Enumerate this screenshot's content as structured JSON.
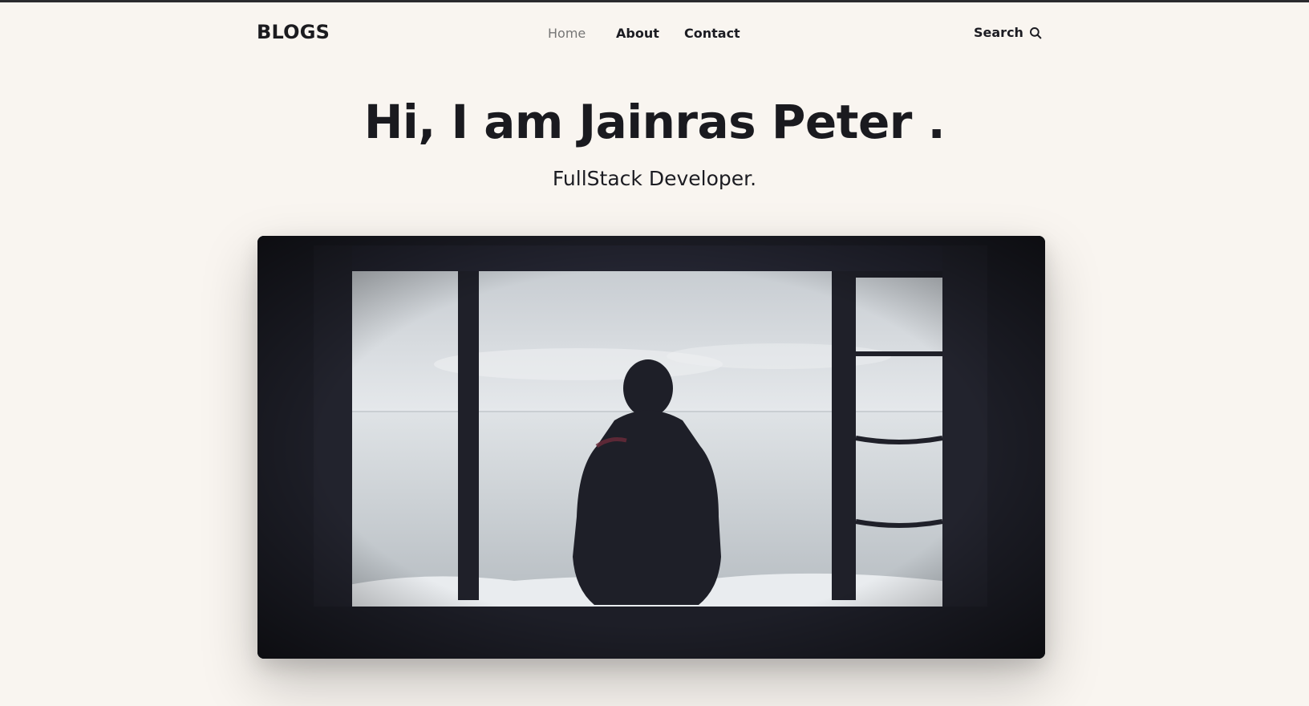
{
  "brand": "BLOGS",
  "nav": {
    "items": [
      {
        "label": "Home",
        "active": true
      },
      {
        "label": "About",
        "active": false
      },
      {
        "label": "Contact",
        "active": false
      }
    ],
    "search_label": "Search"
  },
  "hero": {
    "title": "Hi, I am Jainras Peter .",
    "subtitle": "FullStack Developer."
  },
  "image": {
    "subject": "person-silhouette-looking-at-sea-through-window"
  },
  "icons": {
    "search": "search-icon"
  },
  "colors": {
    "background": "#f9f5f0",
    "text": "#1c1c22",
    "nav_active": "#767676",
    "photo_frame": "#1d1e27"
  }
}
